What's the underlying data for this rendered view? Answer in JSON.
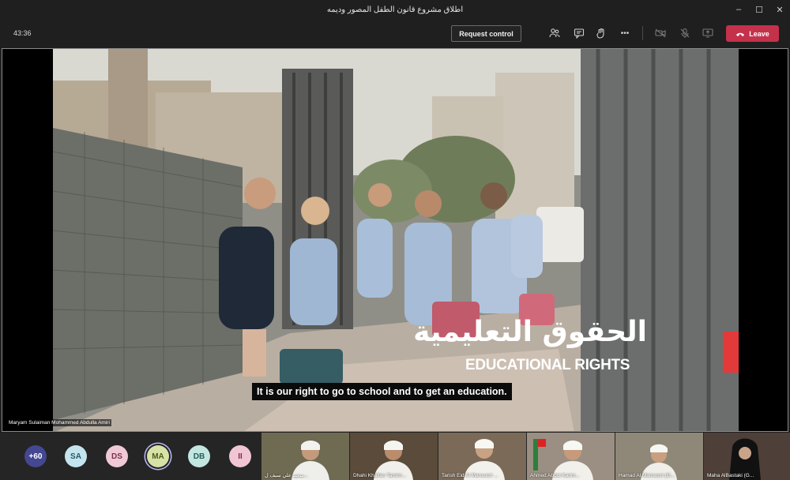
{
  "window": {
    "title": "اطلاق مشروع قانون الطفل المصور وديمه",
    "minimize": "–",
    "maximize": "☐",
    "close": "✕"
  },
  "toolbar": {
    "timer": "43:36",
    "request_control": "Request control",
    "more": "•••",
    "leave": "Leave"
  },
  "video": {
    "caption": "It is our right to go to school and to get an education.",
    "overlay_arabic": "الحقوق التعليمية",
    "overlay_english": "EDUCATIONAL RIGHTS",
    "speaker_name": "Maryam Sulaiman Mohammed Abdulla Amiri"
  },
  "participants": {
    "overflow_count": "+60",
    "avatars": [
      {
        "initials": "SA",
        "color": "#c4e4ee",
        "text_color": "#2b5a6a"
      },
      {
        "initials": "DS",
        "color": "#f0c9d6",
        "text_color": "#7a3350"
      },
      {
        "initials": "MA",
        "color": "#d7e2a6",
        "text_color": "#4f5a1a"
      },
      {
        "initials": "DB",
        "color": "#c3e6e1",
        "text_color": "#23605a"
      },
      {
        "initials": "II",
        "color": "#f1c6d4",
        "text_color": "#7c2f4a"
      }
    ],
    "tiles": [
      {
        "name": "سعيد علي سيف ل...",
        "bg": "#6f6a52"
      },
      {
        "name": "Dhahi Khalfan Tamim...",
        "bg": "#5a4b3a"
      },
      {
        "name": "Tarish Eid Al Mansoori ...",
        "bg": "#7a6a57"
      },
      {
        "name": "Ahmed Abdul Karim...",
        "bg": "#9a8f82"
      },
      {
        "name": "Hamad Al Mansoori (G...",
        "bg": "#8f8878"
      },
      {
        "name": "Maha AlBastaki (G...",
        "bg": "#4e4038"
      }
    ]
  },
  "colors": {
    "leave": "#c4314b",
    "overlay_bar": "#e23a3a",
    "overflow_avatar": "#444791"
  }
}
